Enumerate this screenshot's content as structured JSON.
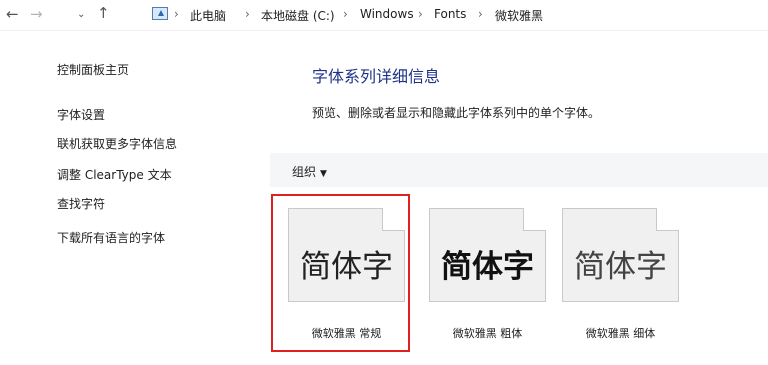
{
  "address_bar": {
    "back_glyph": "←",
    "forward_glyph": "→",
    "history_glyph": "⌄",
    "up_glyph": "↑",
    "separator": "›",
    "crumbs": [
      "此电脑",
      "本地磁盘 (C:)",
      "Windows",
      "Fonts",
      "微软雅黑"
    ]
  },
  "sidebar": {
    "items": [
      "控制面板主页",
      "字体设置",
      "联机获取更多字体信息",
      "调整 ClearType 文本",
      "查找字符",
      "下载所有语言的字体"
    ]
  },
  "main": {
    "title": "字体系列详细信息",
    "description": "预览、删除或者显示和隐藏此字体系列中的单个字体。",
    "organize_label": "组织",
    "organize_arrow": "▼",
    "fonts": [
      {
        "sample": "简体字",
        "name": "微软雅黑 常规",
        "weight": "regular",
        "selected": true
      },
      {
        "sample": "简体字",
        "name": "微软雅黑 粗体",
        "weight": "bold",
        "selected": false
      },
      {
        "sample": "简体字",
        "name": "微软雅黑 细体",
        "weight": "light",
        "selected": false
      }
    ]
  },
  "colors": {
    "title": "#1e3287",
    "highlight_border": "#e02020",
    "command_bar": "#f5f6f7"
  }
}
